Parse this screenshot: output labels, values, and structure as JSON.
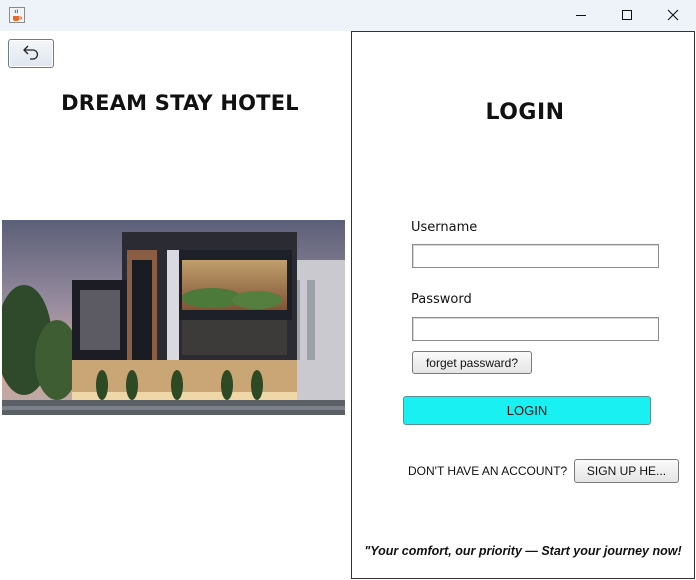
{
  "window": {
    "app_icon": "java-cup-icon",
    "controls": [
      "minimize-icon",
      "maximize-icon",
      "close-icon"
    ]
  },
  "left": {
    "back_icon": "back-arrow-icon",
    "hotel_name": "DREAM STAY HOTEL",
    "photo": "hotel-building-photo"
  },
  "login": {
    "title": "LOGIN",
    "username_label": "Username",
    "username_value": "",
    "password_label": "Password",
    "password_value": "",
    "forget_button": "forget passward?",
    "login_button": "LOGIN",
    "no_account_text": "DON'T HAVE AN ACCOUNT?",
    "signup_button": "SIGN UP HE...",
    "tagline": "\"Your comfort, our priority — Start your journey now!"
  },
  "colors": {
    "login_button": "#18f0f2",
    "titlebar": "#eef3f9"
  }
}
